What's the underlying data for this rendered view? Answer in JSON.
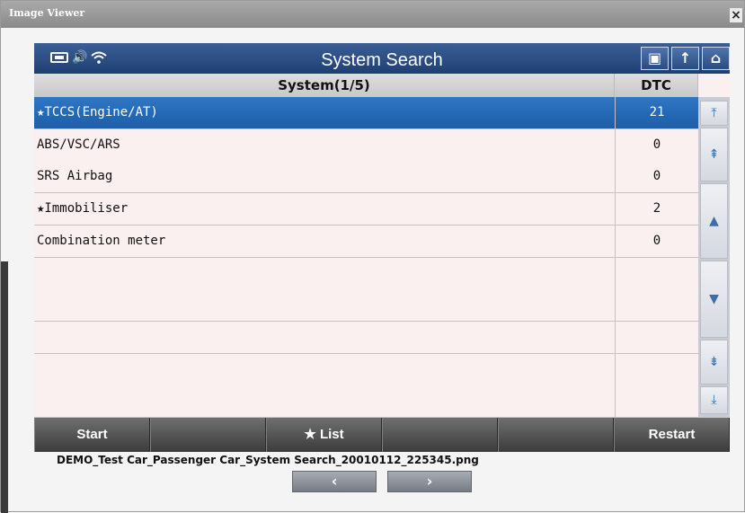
{
  "window": {
    "title": "Image Viewer",
    "close_label": "×"
  },
  "header": {
    "title": "System Search",
    "status_icons": [
      "battery-icon",
      "speaker-icon",
      "wifi-icon"
    ],
    "buttons": [
      {
        "icon": "screen-icon",
        "glyph": "▣"
      },
      {
        "icon": "up-arrow-icon",
        "glyph": "↑"
      },
      {
        "icon": "home-icon",
        "glyph": "⌂"
      }
    ]
  },
  "table": {
    "col_system": "System(1/5)",
    "col_dtc": "DTC",
    "rows": [
      {
        "system": "★TCCS(Engine/AT)",
        "dtc": "21",
        "selected": true
      },
      {
        "system": "ABS/VSC/ARS",
        "dtc": "0"
      },
      {
        "system": "SRS Airbag",
        "dtc": "0"
      },
      {
        "system": "★Immobiliser",
        "dtc": "2"
      },
      {
        "system": "Combination meter",
        "dtc": "0"
      },
      {
        "system": "",
        "dtc": ""
      },
      {
        "system": "",
        "dtc": ""
      },
      {
        "system": "",
        "dtc": ""
      },
      {
        "system": "",
        "dtc": ""
      },
      {
        "system": "",
        "dtc": ""
      }
    ]
  },
  "scrollbar": {
    "first_glyph": "⤒",
    "page_up_glyph": "⇞",
    "up_glyph": "▲",
    "down_glyph": "▼",
    "page_down_glyph": "⇟",
    "last_glyph": "⤓"
  },
  "toolbar": {
    "start": "Start",
    "list": "★ List",
    "restart": "Restart"
  },
  "footer": {
    "filename": "DEMO_Test Car_Passenger Car_System Search_20010112_225345.png",
    "prev": "‹",
    "next": "›"
  },
  "colors": {
    "header": "#1f3f73",
    "selected_row": "#1c5ea9",
    "row_bg": "#fbf0f0",
    "toolbar": "#3c3c3c"
  }
}
